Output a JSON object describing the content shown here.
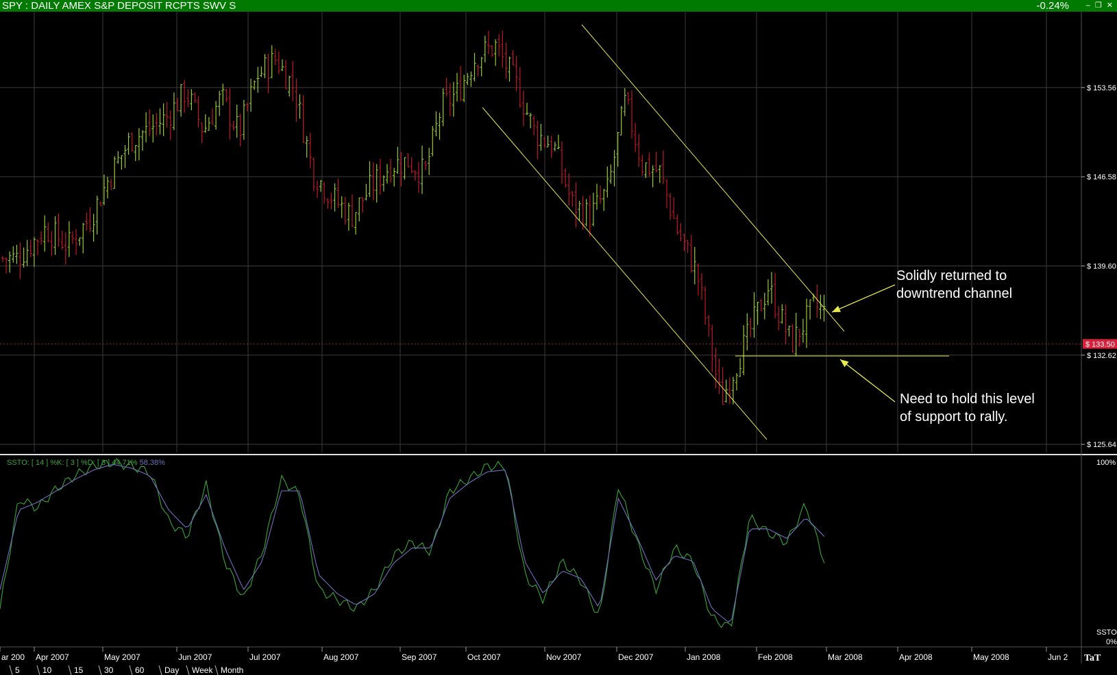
{
  "window": {
    "title": "SPY : DAILY AMEX S&P DEPOSIT RCPTS SWV S",
    "change": "-0.24%",
    "buttons": "– ❐ ✕"
  },
  "colors": {
    "background": "#000000",
    "titlebar": "#007a00",
    "up_bar": "#9acd32",
    "down_bar": "#c0182a",
    "grid": "#3c3c3c",
    "trendline": "#e8e850",
    "stoch_k": "#3aa53a",
    "stoch_d": "#7070c0",
    "last_price_tag": "#d8203a"
  },
  "chart_data": [
    {
      "type": "ohlc",
      "title": "SPY : DAILY AMEX S&P DEPOSIT RCPTS SWV S",
      "y_ticks": [
        {
          "value": 153.56,
          "label": "$ 153.56"
        },
        {
          "value": 146.58,
          "label": "$ 146.58"
        },
        {
          "value": 139.6,
          "label": "$ 139.60"
        },
        {
          "value": 132.62,
          "label": "$ 132.62"
        },
        {
          "value": 125.64,
          "label": "$ 125.64"
        }
      ],
      "last_price": {
        "value": 133.5,
        "label": "$ 133.50"
      },
      "ylim": [
        125.0,
        159.5
      ],
      "x_labels": [
        "ar 200",
        "Apr 2007",
        "May 2007",
        "Jun 2007",
        "Jul 2007",
        "Aug 2007",
        "Sep 2007",
        "Oct 2007",
        "Nov 2007",
        "Dec 2007",
        "Jan 2008",
        "Feb 2008",
        "Mar 2008",
        "Apr 2008",
        "May 2008",
        "Jun 2"
      ],
      "close_path": [
        [
          "ar 200",
          140.2
        ],
        [
          "Apr 2007",
          142.5
        ],
        [
          "Apr 2007",
          141.2
        ],
        [
          "Apr 2007",
          143.5
        ],
        [
          "May 2007",
          147.0
        ],
        [
          "May 2007",
          149.5
        ],
        [
          "May 2007",
          150.3
        ],
        [
          "May 2007",
          151.3
        ],
        [
          "Jun 2007",
          153.3
        ],
        [
          "Jun 2007",
          150.2
        ],
        [
          "Jun 2007",
          152.8
        ],
        [
          "Jun 2007",
          150.0
        ],
        [
          "Jul 2007",
          154.5
        ],
        [
          "Jul 2007",
          155.8
        ],
        [
          "Jul 2007",
          153.5
        ],
        [
          "Jul 2007",
          147.0
        ],
        [
          "Aug 2007",
          145.0
        ],
        [
          "Aug 2007",
          143.5
        ],
        [
          "Aug 2007",
          145.8
        ],
        [
          "Aug 2007",
          147.5
        ],
        [
          "Sep 2007",
          147.8
        ],
        [
          "Sep 2007",
          146.8
        ],
        [
          "Sep 2007",
          152.0
        ],
        [
          "Sep 2007",
          153.2
        ],
        [
          "Oct 2007",
          156.0
        ],
        [
          "Oct 2007",
          156.8
        ],
        [
          "Oct 2007",
          154.0
        ],
        [
          "Oct 2007",
          150.0
        ],
        [
          "Nov 2007",
          149.0
        ],
        [
          "Nov 2007",
          144.5
        ],
        [
          "Nov 2007",
          143.5
        ],
        [
          "Nov 2007",
          145.5
        ],
        [
          "Dec 2007",
          152.5
        ],
        [
          "Dec 2007",
          147.5
        ],
        [
          "Dec 2007",
          147.0
        ],
        [
          "Dec 2007",
          142.5
        ],
        [
          "Jan 2008",
          139.0
        ],
        [
          "Jan 2008",
          129.0
        ],
        [
          "Jan 2008",
          133.5
        ],
        [
          "Feb 2008",
          138.0
        ],
        [
          "Feb 2008",
          133.5
        ],
        [
          "Feb 2008",
          136.5
        ],
        [
          "Mar 2008",
          133.5
        ]
      ]
    },
    {
      "type": "line",
      "title": "SSTO",
      "legend": {
        "label": "SSTO: [ 14 ] %K: [ 3 ] %D: [ 3 ]",
        "k_value": "44.71%",
        "d_value": "58.38%"
      },
      "ylim": [
        0,
        100
      ],
      "y_labels": {
        "top": "100%",
        "bottom": "0%",
        "name": "SSTO"
      },
      "series": [
        {
          "name": "%K",
          "values": [
            20,
            78,
            73,
            83,
            90,
            95,
            97,
            95,
            92,
            66,
            58,
            85,
            45,
            25,
            50,
            88,
            80,
            30,
            25,
            20,
            30,
            48,
            55,
            50,
            82,
            88,
            95,
            95,
            38,
            25,
            45,
            35,
            15,
            85,
            55,
            30,
            52,
            45,
            15,
            10,
            68,
            60,
            55,
            75,
            45
          ]
        },
        {
          "name": "%D",
          "values": [
            30,
            72,
            76,
            82,
            88,
            93,
            96,
            94,
            90,
            72,
            62,
            80,
            52,
            30,
            45,
            82,
            82,
            38,
            28,
            22,
            28,
            44,
            52,
            52,
            78,
            86,
            92,
            93,
            45,
            28,
            40,
            36,
            20,
            78,
            58,
            35,
            48,
            45,
            20,
            12,
            62,
            62,
            57,
            68,
            58
          ]
        }
      ]
    }
  ],
  "annotations": [
    {
      "text_lines": [
        "Solidly returned to",
        "downtrend channel"
      ]
    },
    {
      "text_lines": [
        "Need to hold this level",
        "of support to rally."
      ]
    }
  ],
  "timeframe_tabs": [
    "5",
    "10",
    "15",
    "30",
    "60",
    "Day",
    "Week",
    "Month"
  ],
  "corner_logo": "TaT"
}
